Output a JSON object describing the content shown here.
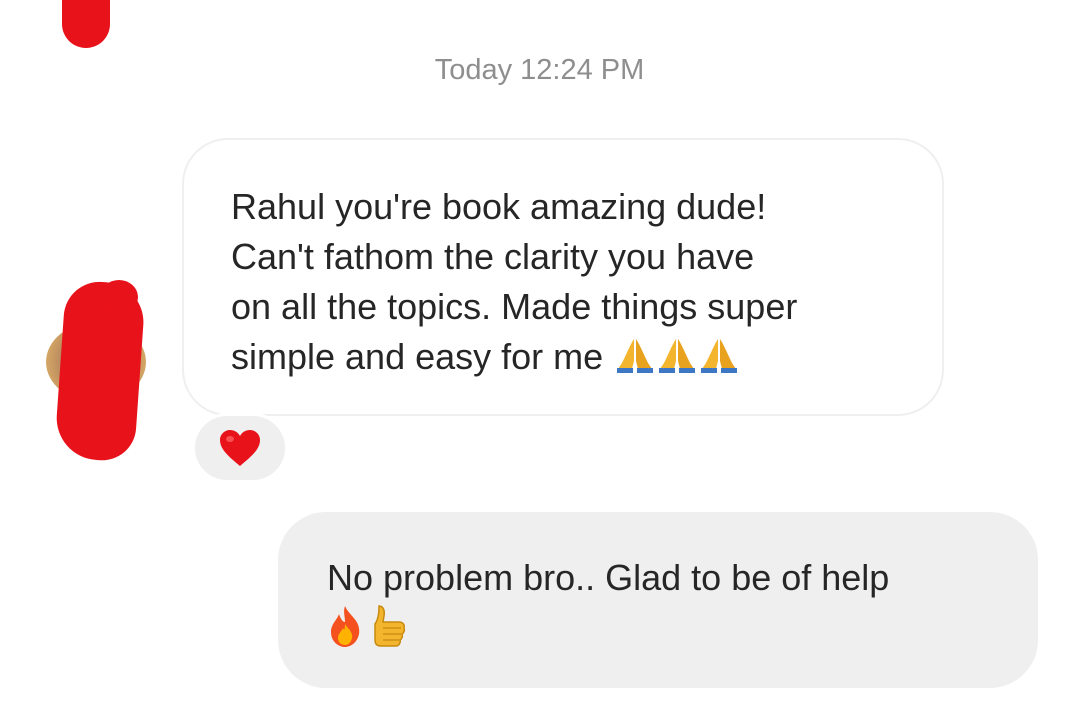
{
  "timestamp": "Today 12:24 PM",
  "incoming": {
    "text": "Rahul you're book amazing dude!\nCan't fathom the clarity you have\non all the topics. Made things super\nsimple and easy for me",
    "trailing_emoji": "folded-hands-icon x3",
    "reaction": "red-heart-icon"
  },
  "outgoing": {
    "text": "No problem bro.. Glad to be of help",
    "trailing_emoji": [
      "fire-icon",
      "thumbs-up-icon"
    ]
  },
  "colors": {
    "redaction": "#e8121b",
    "outgoing_bubble": "#efefef",
    "incoming_border": "#efefef",
    "timestamp": "#8e8e8e",
    "text": "#262626"
  }
}
